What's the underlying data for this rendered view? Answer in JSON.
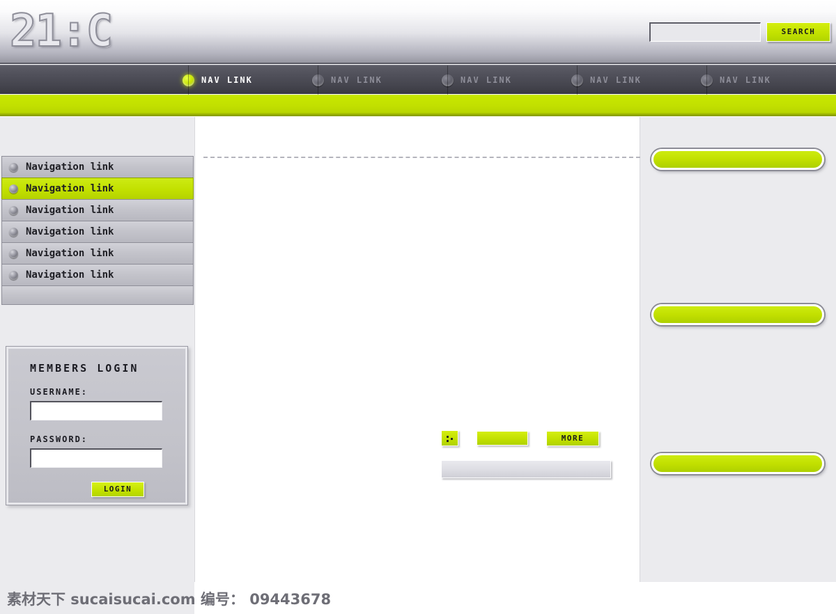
{
  "header": {
    "logo_text": "21:C",
    "search": {
      "value": "",
      "placeholder": "",
      "button_label": "SEARCH"
    }
  },
  "navbar": {
    "items": [
      {
        "label": "NAV LINK",
        "active": true
      },
      {
        "label": "NAV LINK",
        "active": false
      },
      {
        "label": "NAV LINK",
        "active": false
      },
      {
        "label": "NAV LINK",
        "active": false
      },
      {
        "label": "NAV LINK",
        "active": false
      }
    ]
  },
  "sidebar": {
    "nav_items": [
      {
        "label": "Navigation link",
        "active": false
      },
      {
        "label": "Navigation link",
        "active": true
      },
      {
        "label": "Navigation link",
        "active": false
      },
      {
        "label": "Navigation link",
        "active": false
      },
      {
        "label": "Navigation link",
        "active": false
      },
      {
        "label": "Navigation link",
        "active": false
      }
    ],
    "login": {
      "title": "MEMBERS LOGIN",
      "username_label": "USERNAME:",
      "username_value": "",
      "password_label": "PASSWORD:",
      "password_value": "",
      "button_label": "LOGIN"
    }
  },
  "content": {
    "more_label": "MORE",
    "blank_button_label": "",
    "icon_button_name": "dots-icon"
  },
  "right_rail": {
    "buttons": [
      {
        "label": ""
      },
      {
        "label": ""
      },
      {
        "label": ""
      }
    ]
  },
  "footer": {
    "watermark": "素材天下 sucaisucai.com  编号： 09443678"
  },
  "colors": {
    "accent_green": "#c2e000",
    "nav_dark": "#4e4e58",
    "panel_gray": "#ebebee",
    "button_gray": "#c3c3ca"
  }
}
